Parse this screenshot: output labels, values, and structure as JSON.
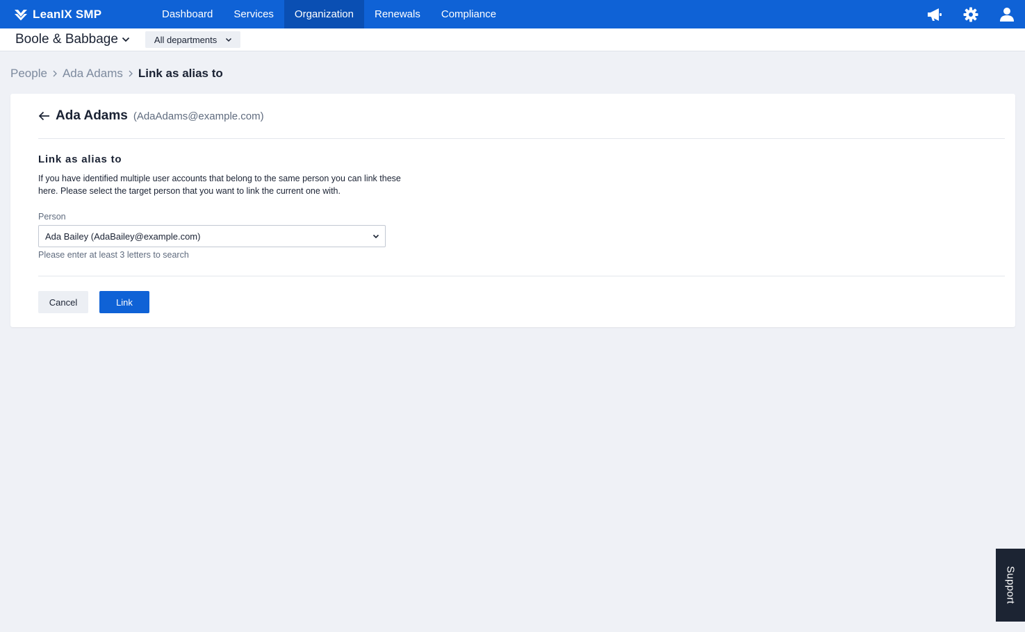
{
  "brand": {
    "name": "LeanIX SMP"
  },
  "nav": {
    "items": [
      {
        "label": "Dashboard"
      },
      {
        "label": "Services"
      },
      {
        "label": "Organization"
      },
      {
        "label": "Renewals"
      },
      {
        "label": "Compliance"
      }
    ],
    "active": "Organization"
  },
  "top_icons": [
    "megaphone-icon",
    "gear-icon",
    "user-icon"
  ],
  "workspace": {
    "name": "Boole & Babbage"
  },
  "department_filter": {
    "value": "All departments"
  },
  "breadcrumb": {
    "items": [
      {
        "label": "People"
      },
      {
        "label": "Ada Adams"
      }
    ],
    "current": "Link as alias to"
  },
  "card": {
    "person_name": "Ada Adams",
    "person_email": "(AdaAdams@example.com)",
    "section_title": "Link as alias to",
    "description": "If you have identified multiple user accounts that belong to the same person you can link these here. Please select the target person that you want to link the current one with.",
    "field": {
      "label": "Person",
      "value": "Ada Bailey (AdaBailey@example.com)",
      "hint": "Please enter at least 3 letters to search"
    },
    "buttons": {
      "cancel": "Cancel",
      "link": "Link"
    }
  },
  "support": {
    "label": "Support"
  },
  "colors": {
    "primary": "#0f62d6",
    "nav_active": "#0a4fb3",
    "background": "#eff1f6"
  }
}
